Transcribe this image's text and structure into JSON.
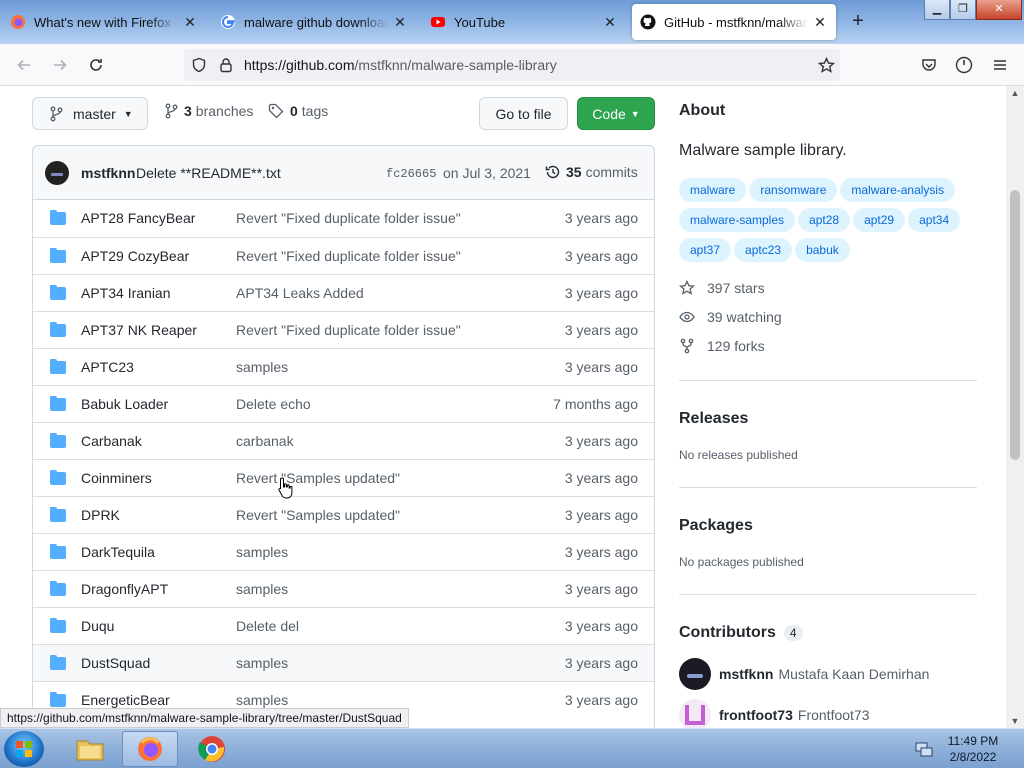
{
  "browser": {
    "tabs": [
      {
        "title": "What's new with Firefox - Mo",
        "icon": "firefox-icon"
      },
      {
        "title": "malware github download - G",
        "icon": "google-icon"
      },
      {
        "title": "YouTube",
        "icon": "youtube-icon"
      },
      {
        "title": "GitHub - mstfknn/malware-s",
        "icon": "github-icon",
        "active": true
      }
    ],
    "url_host": "https://github.com",
    "url_path": "/mstfknn/malware-sample-library",
    "status_url": "https://github.com/mstfknn/malware-sample-library/tree/master/DustSquad"
  },
  "repo": {
    "branch": "master",
    "branches_count": "3",
    "branches_label": "branches",
    "tags_count": "0",
    "tags_label": "tags",
    "go_to_file": "Go to file",
    "code_label": "Code",
    "commit": {
      "author": "mstfknn",
      "message": "Delete **README**.txt",
      "sha": "fc26665",
      "date": "on Jul 3, 2021",
      "commits_count": "35",
      "commits_label": "commits"
    },
    "files": [
      {
        "name": "APT28 FancyBear",
        "message": "Revert \"Fixed duplicate folder issue\"",
        "age": "3 years ago"
      },
      {
        "name": "APT29 CozyBear",
        "message": "Revert \"Fixed duplicate folder issue\"",
        "age": "3 years ago"
      },
      {
        "name": "APT34 Iranian",
        "message": "APT34 Leaks Added",
        "age": "3 years ago"
      },
      {
        "name": "APT37 NK Reaper",
        "message": "Revert \"Fixed duplicate folder issue\"",
        "age": "3 years ago"
      },
      {
        "name": "APTC23",
        "message": "samples",
        "age": "3 years ago"
      },
      {
        "name": "Babuk Loader",
        "message": "Delete echo",
        "age": "7 months ago"
      },
      {
        "name": "Carbanak",
        "message": "carbanak",
        "age": "3 years ago"
      },
      {
        "name": "Coinminers",
        "message": "Revert \"Samples updated\"",
        "age": "3 years ago"
      },
      {
        "name": "DPRK",
        "message": "Revert \"Samples updated\"",
        "age": "3 years ago"
      },
      {
        "name": "DarkTequila",
        "message": "samples",
        "age": "3 years ago"
      },
      {
        "name": "DragonflyAPT",
        "message": "samples",
        "age": "3 years ago"
      },
      {
        "name": "Duqu",
        "message": "Delete del",
        "age": "3 years ago"
      },
      {
        "name": "DustSquad",
        "message": "samples",
        "age": "3 years ago",
        "hover": true
      },
      {
        "name": "EnergeticBear",
        "message": "samples",
        "age": "3 years ago"
      }
    ]
  },
  "about": {
    "heading": "About",
    "description": "Malware sample library.",
    "topics": [
      "malware",
      "ransomware",
      "malware-analysis",
      "malware-samples",
      "apt28",
      "apt29",
      "apt34",
      "apt37",
      "aptc23",
      "babuk"
    ],
    "stars": "397 stars",
    "watching": "39 watching",
    "forks": "129 forks"
  },
  "releases": {
    "heading": "Releases",
    "text": "No releases published"
  },
  "packages": {
    "heading": "Packages",
    "text": "No packages published"
  },
  "contributors": {
    "heading": "Contributors",
    "count": "4",
    "list": [
      {
        "login": "mstfknn",
        "name": "Mustafa Kaan Demirhan"
      },
      {
        "login": "frontfoot73",
        "name": "Frontfoot73"
      }
    ]
  },
  "taskbar": {
    "time": "11:49 PM",
    "date": "2/8/2022"
  }
}
